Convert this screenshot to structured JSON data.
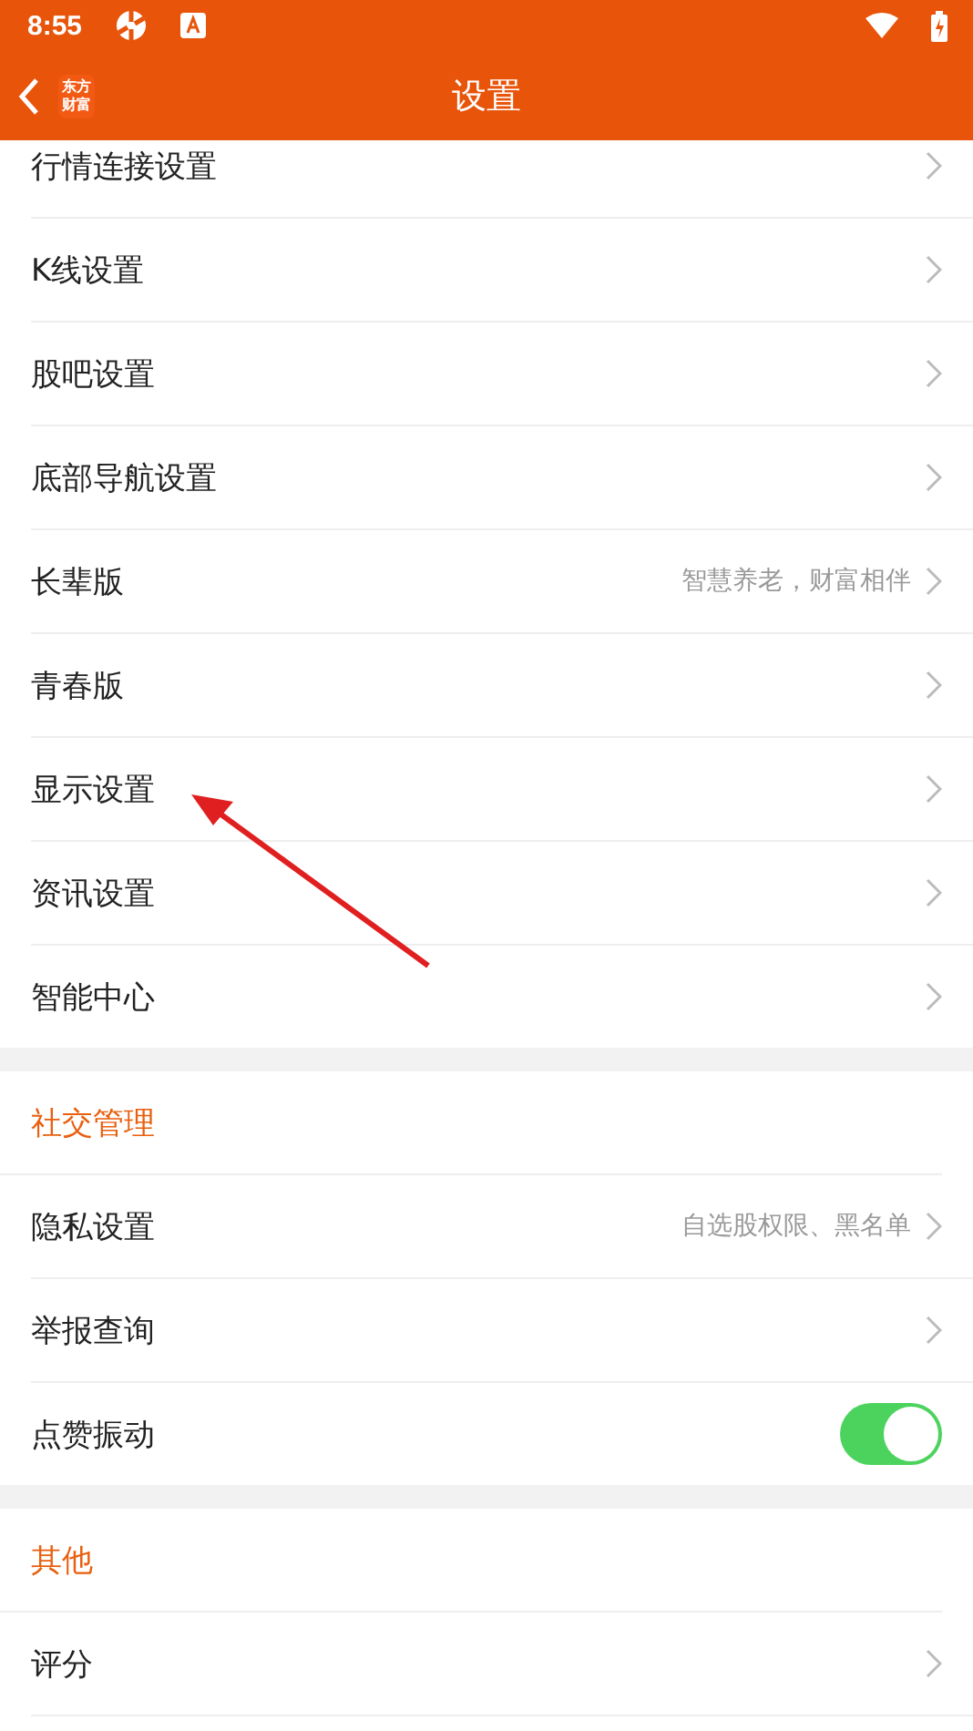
{
  "status_bar": {
    "time": "8:55"
  },
  "header": {
    "logo": "东方财富",
    "title": "设置"
  },
  "sections": [
    {
      "items": [
        {
          "kind": "link",
          "label": "行情连接设置"
        },
        {
          "kind": "link",
          "label": "K线设置"
        },
        {
          "kind": "link",
          "label": "股吧设置"
        },
        {
          "kind": "link",
          "label": "底部导航设置"
        },
        {
          "kind": "link",
          "label": "长辈版",
          "value": "智慧养老，财富相伴"
        },
        {
          "kind": "link",
          "label": "青春版"
        },
        {
          "kind": "link",
          "label": "显示设置"
        },
        {
          "kind": "link",
          "label": "资讯设置"
        },
        {
          "kind": "link",
          "label": "智能中心"
        }
      ]
    },
    {
      "title": "社交管理",
      "items": [
        {
          "kind": "link",
          "label": "隐私设置",
          "value": "自选股权限、黑名单"
        },
        {
          "kind": "link",
          "label": "举报查询"
        },
        {
          "kind": "toggle",
          "label": "点赞振动",
          "on": true
        }
      ]
    },
    {
      "title": "其他",
      "items": [
        {
          "kind": "link",
          "label": "评分"
        }
      ]
    }
  ]
}
